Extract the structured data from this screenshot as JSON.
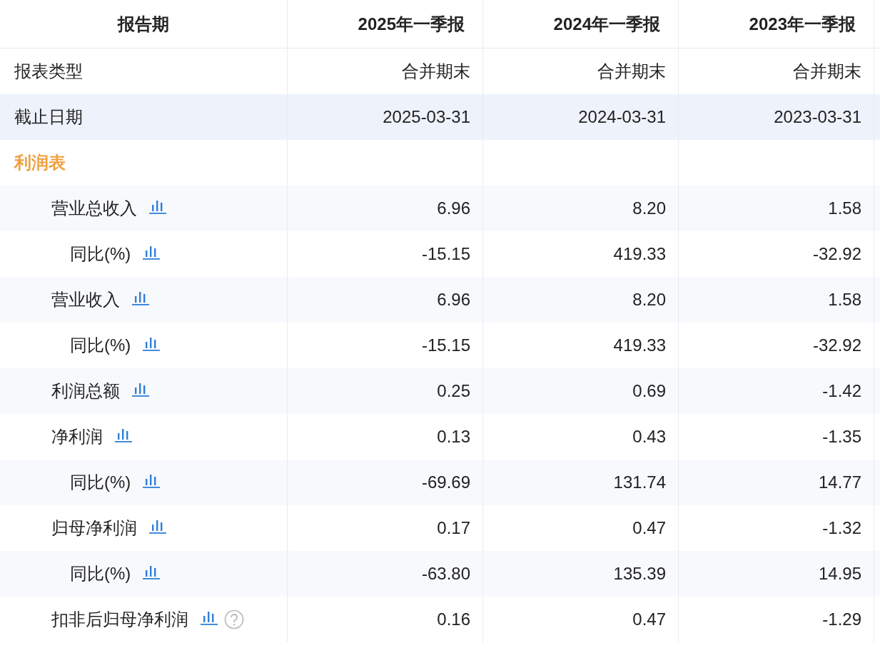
{
  "table": {
    "columns": [
      "报告期",
      "2025年一季报",
      "2024年一季报",
      "2023年一季报"
    ],
    "rows": [
      {
        "kind": "info",
        "label": "报表类型",
        "values": [
          "合并期末",
          "合并期末",
          "合并期末"
        ]
      },
      {
        "kind": "info",
        "label": "截止日期",
        "values": [
          "2025-03-31",
          "2024-03-31",
          "2023-03-31"
        ]
      },
      {
        "kind": "section",
        "label": "利润表",
        "children": [
          {
            "kind": "metric",
            "label": "营业总收入",
            "help": false,
            "values": [
              "6.96",
              "8.20",
              "1.58"
            ],
            "children": [
              {
                "kind": "metric",
                "label": "同比(%)",
                "help": false,
                "values": [
                  "-15.15",
                  "419.33",
                  "-32.92"
                ]
              }
            ]
          },
          {
            "kind": "metric",
            "label": "营业收入",
            "help": false,
            "values": [
              "6.96",
              "8.20",
              "1.58"
            ],
            "children": [
              {
                "kind": "metric",
                "label": "同比(%)",
                "help": false,
                "values": [
                  "-15.15",
                  "419.33",
                  "-32.92"
                ]
              }
            ]
          },
          {
            "kind": "metric",
            "label": "利润总额",
            "help": false,
            "values": [
              "0.25",
              "0.69",
              "-1.42"
            ]
          },
          {
            "kind": "metric",
            "label": "净利润",
            "help": false,
            "values": [
              "0.13",
              "0.43",
              "-1.35"
            ],
            "children": [
              {
                "kind": "metric",
                "label": "同比(%)",
                "help": false,
                "values": [
                  "-69.69",
                  "131.74",
                  "14.77"
                ]
              }
            ]
          },
          {
            "kind": "metric",
            "label": "归母净利润",
            "help": false,
            "values": [
              "0.17",
              "0.47",
              "-1.32"
            ],
            "children": [
              {
                "kind": "metric",
                "label": "同比(%)",
                "help": false,
                "values": [
                  "-63.80",
                  "135.39",
                  "14.95"
                ]
              }
            ]
          },
          {
            "kind": "metric",
            "label": "扣非后归母净利润",
            "help": true,
            "values": [
              "0.16",
              "0.47",
              "-1.29"
            ]
          }
        ]
      }
    ]
  }
}
